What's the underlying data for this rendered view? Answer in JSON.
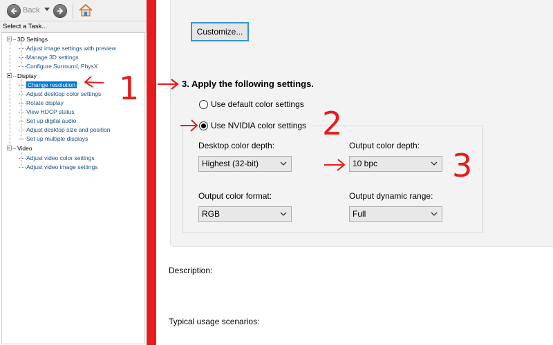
{
  "toolbar": {
    "back_label": "Back",
    "back_icon": "left-arrow-icon",
    "forward_icon": "right-arrow-icon",
    "home_icon": "home-icon"
  },
  "task_panel": {
    "header": "Select a Task...",
    "categories": [
      {
        "label": "3D Settings",
        "items": [
          "Adjust image settings with preview",
          "Manage 3D settings",
          "Configure Surround, PhysX"
        ]
      },
      {
        "label": "Display",
        "items": [
          "Change resolution",
          "Adjust desktop color settings",
          "Rotate display",
          "View HDCP status",
          "Set up digital audio",
          "Adjust desktop size and position",
          "Set up multiple displays"
        ]
      },
      {
        "label": "Video",
        "items": [
          "Adjust video color settings",
          "Adjust video image settings"
        ]
      }
    ],
    "selected_item": "Change resolution"
  },
  "main": {
    "customize_label": "Customize...",
    "step_title": "3. Apply the following settings.",
    "radio_default_label": "Use default color settings",
    "radio_nvidia_label": "Use NVIDIA color settings",
    "selected_radio": "nvidia",
    "desktop_color_depth": {
      "label": "Desktop color depth:",
      "value": "Highest (32-bit)"
    },
    "output_color_depth": {
      "label": "Output color depth:",
      "value": "10 bpc"
    },
    "output_color_format": {
      "label": "Output color format:",
      "value": "RGB"
    },
    "output_dynamic_range": {
      "label": "Output dynamic range:",
      "value": "Full"
    },
    "description_label": "Description:",
    "usage_label": "Typical usage scenarios:"
  },
  "annotations": {
    "numbers": [
      "1",
      "2",
      "3"
    ],
    "color": "#e51c1c"
  }
}
